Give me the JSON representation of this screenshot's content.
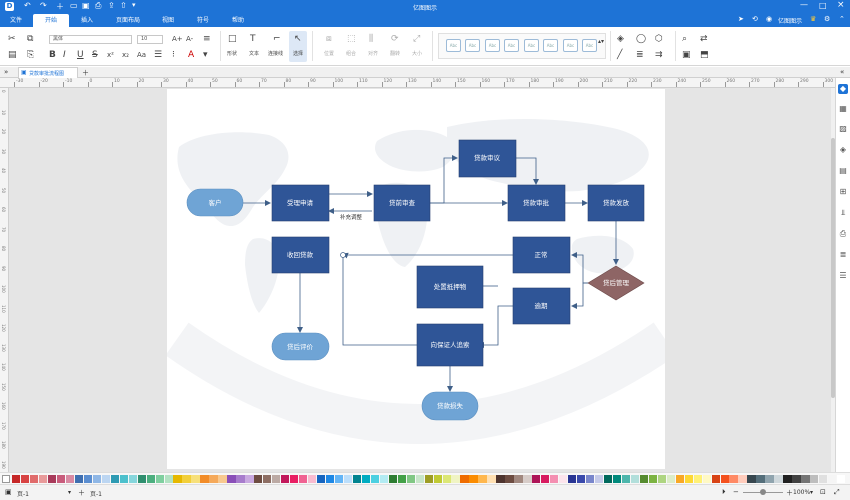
{
  "app": {
    "title": "亿图图示"
  },
  "tabs": [
    {
      "label": "文件"
    },
    {
      "label": "开始"
    },
    {
      "label": "插入"
    },
    {
      "label": "页面布局"
    },
    {
      "label": "视图"
    },
    {
      "label": "符号"
    },
    {
      "label": "帮助"
    }
  ],
  "account": {
    "label": "亿图图示"
  },
  "ribbon": {
    "font_name": "黑体",
    "font_size": "10",
    "shape_label": "形状",
    "text_label": "文本",
    "connector_label": "连接线",
    "select_label": "选择",
    "position_label": "位置",
    "group_label": "组合",
    "align_label": "对齐",
    "rotate_label": "翻转",
    "size_label": "大小",
    "style_box_text": "Abc"
  },
  "document": {
    "tab_label": "贷款审批流程图"
  },
  "ruler": {
    "top": [
      "-30",
      "-20",
      "-10",
      "0",
      "10",
      "20",
      "30",
      "40",
      "50",
      "60",
      "70",
      "80",
      "90",
      "100",
      "110",
      "120",
      "130",
      "140",
      "150",
      "160",
      "170",
      "180",
      "190",
      "200",
      "210",
      "220",
      "230",
      "240",
      "250",
      "260",
      "270",
      "280",
      "290",
      "300"
    ],
    "left": [
      "0",
      "10",
      "20",
      "30",
      "40",
      "50",
      "60",
      "70",
      "80",
      "90",
      "100",
      "110",
      "120",
      "130",
      "140",
      "150",
      "160",
      "170",
      "180",
      "190"
    ]
  },
  "flow": {
    "customer": "客户",
    "accept": "受理申请",
    "pre_review": "贷前审查",
    "review": "贷款审议",
    "approve": "贷款审批",
    "disburse": "贷款发放",
    "post_manage": "贷后管理",
    "normal": "正常",
    "overdue": "逾期",
    "collect": "收回贷款",
    "collateral": "处置抵押物",
    "guarantor": "向保证人追索",
    "evaluation": "贷后评价",
    "loss": "贷款损失",
    "supplement": "补充调整"
  },
  "status": {
    "page_select": "页-1",
    "page_tab": "页-1",
    "zoom": "100%"
  },
  "palette": [
    "#c62828",
    "#d84343",
    "#e06b6b",
    "#e89a9a",
    "#a83a5a",
    "#c85c7c",
    "#d98aa3",
    "#3f6fb0",
    "#5b8ed0",
    "#8fb7e6",
    "#bcd6f2",
    "#2e9bb3",
    "#4cc0cc",
    "#86d6dc",
    "#2f8f6f",
    "#4caf7f",
    "#7fcf9f",
    "#b2e2c2",
    "#e6b800",
    "#f2cf3a",
    "#f7e07a",
    "#f28c28",
    "#f5a95a",
    "#f8c98f",
    "#8a4fb8",
    "#a77ccc",
    "#c9a9e0",
    "#6d4c41",
    "#8d6e63",
    "#bcaaa4",
    "#c2185b",
    "#e91e63",
    "#f06292",
    "#f8bbd0",
    "#1565c0",
    "#1e88e5",
    "#64b5f6",
    "#bbdefb",
    "#00838f",
    "#00acc1",
    "#4dd0e1",
    "#b2ebf2",
    "#2e7d32",
    "#43a047",
    "#81c784",
    "#c8e6c9",
    "#9e9d24",
    "#c0ca33",
    "#dce775",
    "#f0f4c3",
    "#ef6c00",
    "#fb8c00",
    "#ffb74d",
    "#ffe0b2",
    "#4e342e",
    "#6d4c41",
    "#a1887f",
    "#d7ccc8",
    "#ad1457",
    "#d81b60",
    "#f48fb1",
    "#fce4ec",
    "#283593",
    "#3949ab",
    "#7986cb",
    "#c5cae9",
    "#00695c",
    "#00897b",
    "#4db6ac",
    "#b2dfdb",
    "#558b2f",
    "#7cb342",
    "#aed581",
    "#dcedc8",
    "#f9a825",
    "#fdd835",
    "#fff176",
    "#fff9c4",
    "#d84315",
    "#f4511e",
    "#ff8a65",
    "#ffccbc",
    "#37474f",
    "#546e7a",
    "#90a4ae",
    "#cfd8dc",
    "#212121",
    "#424242",
    "#757575",
    "#bdbdbd",
    "#e0e0e0",
    "#f5f5f5",
    "#ffffff"
  ]
}
